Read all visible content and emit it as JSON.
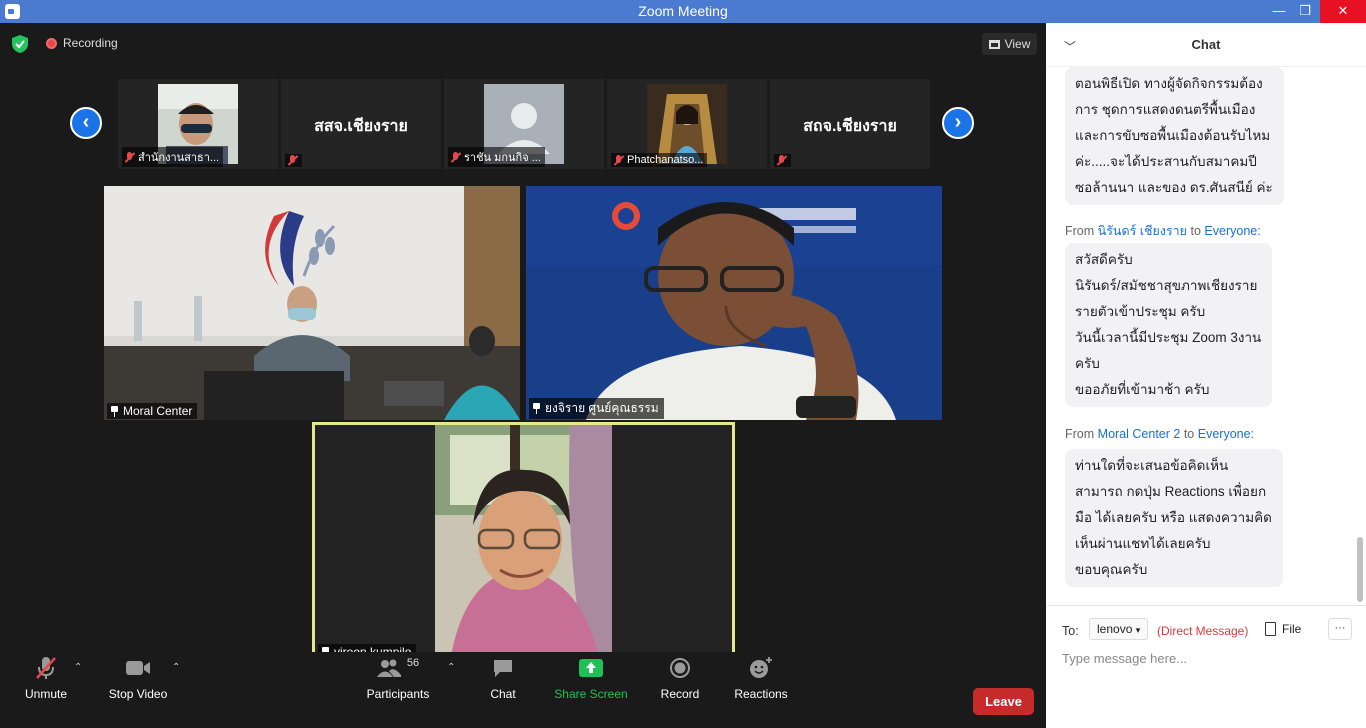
{
  "window": {
    "title": "Zoom Meeting"
  },
  "status": {
    "recording": "Recording",
    "view": "View"
  },
  "gallery_strip": [
    {
      "name": "สำนักงานสาธา...",
      "type": "photo",
      "muted": true
    },
    {
      "name": "สสจ.เชียงราย",
      "type": "text",
      "muted": true
    },
    {
      "name": "ราชัน มกนกิจ ...",
      "type": "avatar",
      "muted": true
    },
    {
      "name": "Phatchanatso...",
      "type": "photo",
      "muted": true
    },
    {
      "name": "สถจ.เชียงราย",
      "type": "text",
      "muted": true
    }
  ],
  "main_tiles": [
    {
      "name": "Moral Center"
    },
    {
      "name": "ยงจิราย ศูนย์คุณธรรม"
    },
    {
      "name": "viroon kumpilo"
    }
  ],
  "toolbar": {
    "unmute": "Unmute",
    "stop_video": "Stop Video",
    "participants": "Participants",
    "participants_count": "56",
    "chat": "Chat",
    "share_screen": "Share Screen",
    "record": "Record",
    "reactions": "Reactions",
    "leave": "Leave"
  },
  "chat": {
    "title": "Chat",
    "messages": [
      {
        "lines": [
          "ตอนพิธีเปิด ทางผู้จัดกิจกรรมต้อง",
          "การ ชุดการแสดงดนตรีพื้นเมือง",
          "และการขับซอพื้นเมืองต้อนรับไหม",
          "ค่ะ.....จะได้ประสานกับสมาคมปี",
          "ซอล้านนา และของ ดร.ศันสนีย์ ค่ะ"
        ]
      },
      {
        "from_prefix": "From",
        "sender": "นิรันดร์ เชียงราย",
        "to_word": "to",
        "recipient": "Everyone:",
        "lines": [
          "สวัสดีครับ",
          "นิรันดร์/สมัชชาสุขภาพเชียงราย",
          "รายตัวเข้าประชุม ครับ",
          "วันนี้เวลานี้มีประชุม Zoom 3งาน",
          "ครับ",
          "ขออภัยที่เข้ามาช้า ครับ"
        ]
      },
      {
        "from_prefix": "From",
        "sender": "Moral Center 2",
        "to_word": "to",
        "recipient": "Everyone:",
        "lines": [
          "ท่านใดที่จะเสนอข้อคิดเห็น",
          "สามารถ กดปุ่ม Reactions เพื่อยก",
          "มือ ได้เลยครับ หรือ แสดงความคิด",
          "เห็นผ่านแชทได้เลยครับ",
          "ขอบคุณครับ"
        ]
      }
    ],
    "to_label": "To:",
    "to_recipient": "lenovo",
    "direct_message": "(Direct Message)",
    "file": "File",
    "input_placeholder": "Type message here..."
  },
  "colors": {
    "accent": "#1b73e8",
    "leave": "#c72a2a",
    "share": "#1fc157",
    "active_speaker": "#e3e88a"
  }
}
